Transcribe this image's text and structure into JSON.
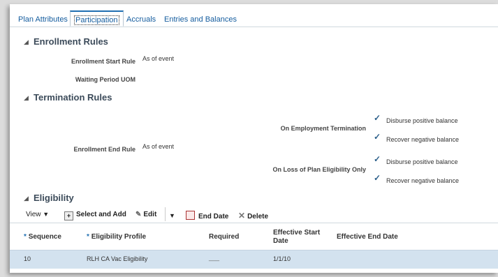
{
  "tabs": [
    {
      "label": "Plan Attributes"
    },
    {
      "label": "Participation"
    },
    {
      "label": "Accruals"
    },
    {
      "label": "Entries and Balances"
    }
  ],
  "enrollment_rules": {
    "title": "Enrollment Rules",
    "start_rule_label": "Enrollment Start Rule",
    "start_rule_value": "As of event",
    "waiting_period_label": "Waiting Period UOM"
  },
  "termination_rules": {
    "title": "Termination Rules",
    "end_rule_label": "Enrollment End Rule",
    "end_rule_value": "As of event",
    "on_employment_termination_label": "On Employment Termination",
    "on_loss_label": "On Loss of Plan Eligibility Only",
    "option_disburse": "Disburse positive balance",
    "option_recover": "Recover negative balance"
  },
  "eligibility": {
    "title": "Eligibility",
    "toolbar": {
      "view": "View",
      "select_and_add": "Select and Add",
      "edit": "Edit",
      "end_date": "End Date",
      "delete": "Delete"
    },
    "columns": {
      "sequence": "Sequence",
      "eligibility_profile": "Eligibility Profile",
      "required": "Required",
      "effective_start_1": "Effective Start",
      "effective_start_2": "Date",
      "effective_end": "Effective End Date",
      "required_marker": "*"
    },
    "rows": [
      {
        "sequence": "10",
        "profile": "RLH CA Vac Eligibility",
        "required": "___",
        "start": "1/1/10",
        "end": ""
      }
    ]
  },
  "colors": {
    "accent": "#1f6fb2",
    "selected_row": "#d3e2ef"
  }
}
